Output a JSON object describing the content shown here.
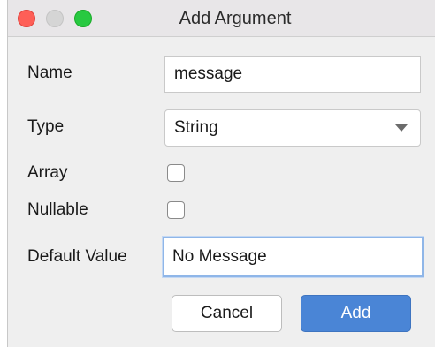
{
  "window": {
    "title": "Add Argument"
  },
  "form": {
    "name_label": "Name",
    "name_value": "message",
    "type_label": "Type",
    "type_value": "String",
    "array_label": "Array",
    "array_checked": false,
    "nullable_label": "Nullable",
    "nullable_checked": false,
    "default_label": "Default Value",
    "default_value": "No Message"
  },
  "buttons": {
    "cancel_label": "Cancel",
    "add_label": "Add"
  },
  "colors": {
    "accent": "#4a85d6",
    "focus_ring": "#8fb6e8"
  },
  "icons": {
    "close": "close-traffic-light",
    "minimize": "minimize-traffic-light",
    "zoom": "zoom-traffic-light",
    "dropdown": "chevron-down-icon"
  }
}
